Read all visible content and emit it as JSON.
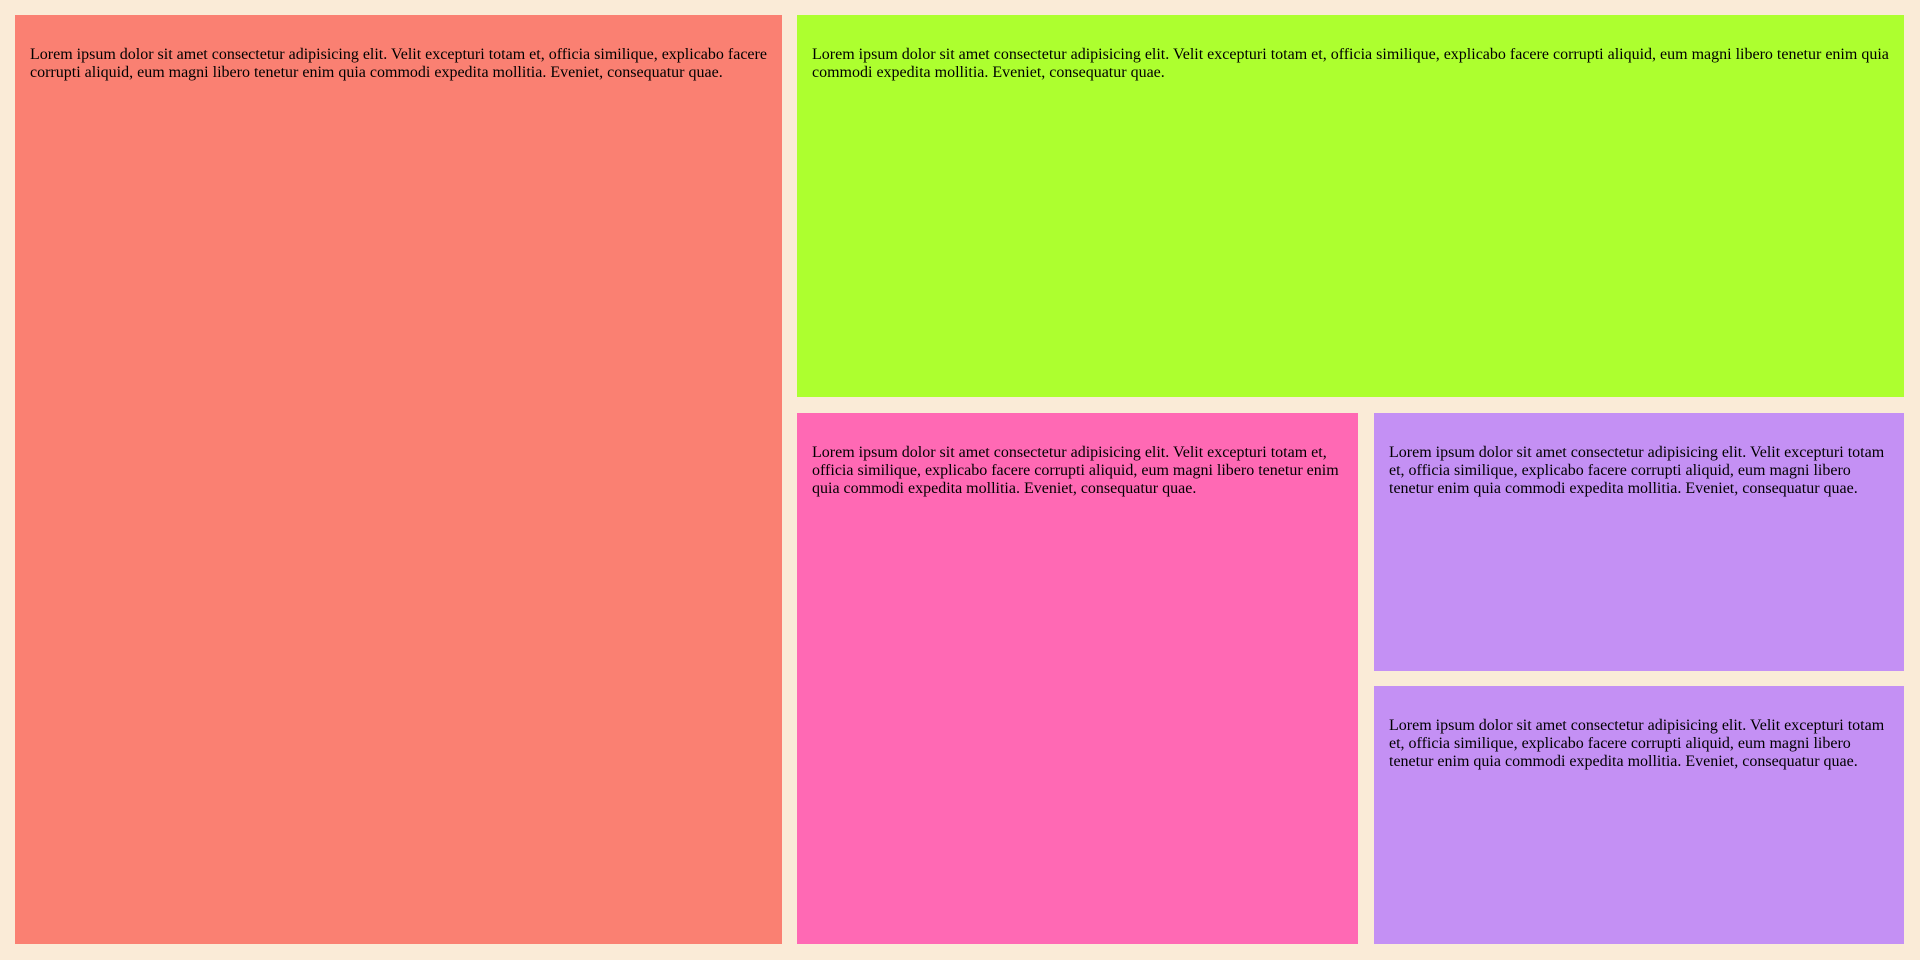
{
  "colors": {
    "background": "#faebd7",
    "panel_left": "#fa8072",
    "panel_top": "#adff2f",
    "panel_bottom_left": "#ff69b4",
    "panel_bottom_right": "#c490f4"
  },
  "panels": [
    {
      "text": "Lorem ipsum dolor sit amet consectetur adipisicing elit. Velit excepturi totam et, officia similique, explicabo facere corrupti aliquid, eum magni libero tenetur enim quia commodi expedita mollitia. Eveniet, consequatur quae."
    },
    {
      "text": "Lorem ipsum dolor sit amet consectetur adipisicing elit. Velit excepturi totam et, officia similique, explicabo facere corrupti aliquid, eum magni libero tenetur enim quia commodi expedita mollitia. Eveniet, consequatur quae."
    },
    {
      "text": "Lorem ipsum dolor sit amet consectetur adipisicing elit. Velit excepturi totam et, officia similique, explicabo facere corrupti aliquid, eum magni libero tenetur enim quia commodi expedita mollitia. Eveniet, consequatur quae."
    },
    {
      "text": "Lorem ipsum dolor sit amet consectetur adipisicing elit. Velit excepturi totam et, officia similique, explicabo facere corrupti aliquid, eum magni libero tenetur enim quia commodi expedita mollitia. Eveniet, consequatur quae."
    },
    {
      "text": "Lorem ipsum dolor sit amet consectetur adipisicing elit. Velit excepturi totam et, officia similique, explicabo facere corrupti aliquid, eum magni libero tenetur enim quia commodi expedita mollitia. Eveniet, consequatur quae."
    }
  ]
}
